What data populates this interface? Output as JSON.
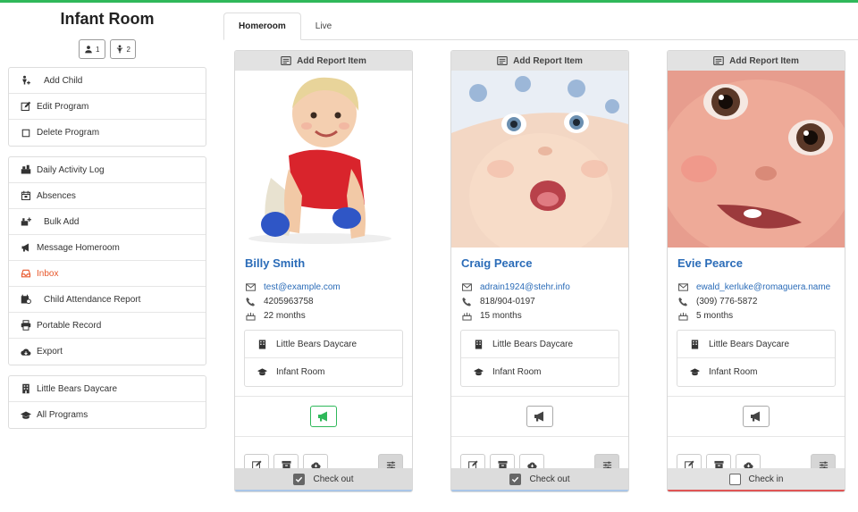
{
  "colors": {
    "accent": "#2fb85a",
    "link": "#2b6cb8",
    "active_menu": "#e8572a"
  },
  "sidebar": {
    "title": "Infant Room",
    "counts": [
      {
        "icon": "users-icon",
        "value": "1"
      },
      {
        "icon": "child-icon",
        "value": "2"
      }
    ],
    "group1": [
      {
        "icon": "add-child-icon",
        "label": "Add Child"
      },
      {
        "icon": "edit-icon",
        "label": "Edit Program"
      },
      {
        "icon": "square-icon",
        "label": "Delete Program"
      }
    ],
    "group2": [
      {
        "icon": "activity-icon",
        "label": "Daily Activity Log"
      },
      {
        "icon": "calendar-icon",
        "label": "Absences"
      },
      {
        "icon": "bulk-add-icon",
        "label": "Bulk Add"
      },
      {
        "icon": "megaphone-icon",
        "label": "Message Homeroom"
      },
      {
        "icon": "inbox-icon",
        "label": "Inbox",
        "active": true
      },
      {
        "icon": "attendance-icon",
        "label": "Child Attendance Report"
      },
      {
        "icon": "print-icon",
        "label": "Portable Record"
      },
      {
        "icon": "cloud-download-icon",
        "label": "Export"
      }
    ],
    "group3": [
      {
        "icon": "building-icon",
        "label": "Little Bears Daycare"
      },
      {
        "icon": "graduation-cap-icon",
        "label": "All Programs"
      }
    ]
  },
  "tabs": [
    {
      "label": "Homeroom",
      "active": true
    },
    {
      "label": "Live",
      "active": false
    }
  ],
  "cards": [
    {
      "header": "Add Report Item",
      "name": "Billy Smith",
      "email": "test@example.com",
      "phone": "4205963758",
      "age": "22 months",
      "school": "Little Bears Daycare",
      "room": "Infant Room",
      "footer_label": "Check out",
      "checked": true
    },
    {
      "header": "Add Report Item",
      "name": "Craig Pearce",
      "email": "adrain1924@stehr.info",
      "phone": "818/904-0197",
      "age": "15 months",
      "school": "Little Bears Daycare",
      "room": "Infant Room",
      "footer_label": "Check out",
      "checked": true
    },
    {
      "header": "Add Report Item",
      "name": "Evie Pearce",
      "email": "ewald_kerluke@romaguera.name",
      "phone": "(309) 776-5872",
      "age": "5 months",
      "school": "Little Bears Daycare",
      "room": "Infant Room",
      "footer_label": "Check in",
      "checked": false
    }
  ]
}
